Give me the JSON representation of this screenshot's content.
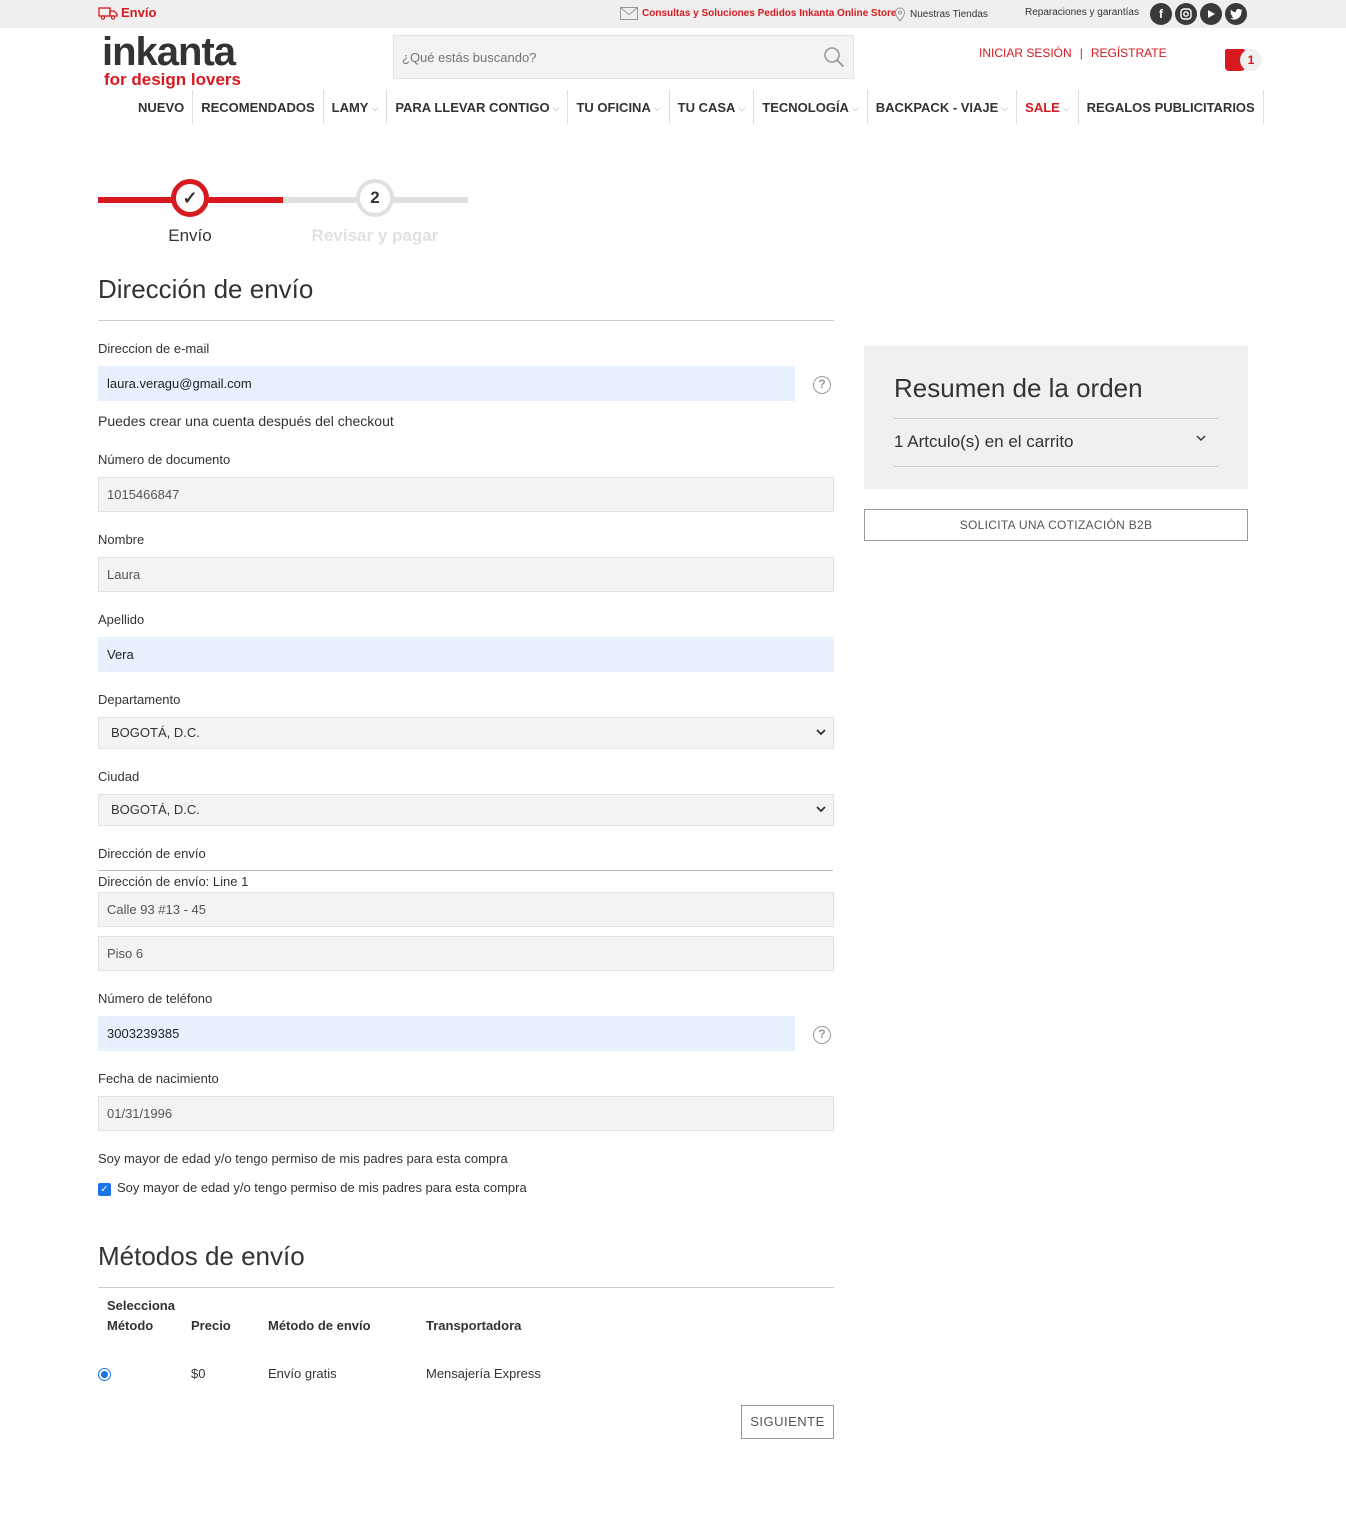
{
  "topbar": {
    "envio": "Envío",
    "consultas": "Consultas y Soluciones Pedidos Inkanta Online Store",
    "tiendas": "Nuestras Tiendas",
    "reparaciones": "Reparaciones y garantías",
    "social": [
      "facebook-icon",
      "instagram-icon",
      "youtube-icon",
      "twitter-icon"
    ]
  },
  "header": {
    "logo_line1": "inkanta",
    "logo_line2": "for design lovers",
    "search_placeholder": "¿Qué estás buscando?",
    "login": "INICIAR SESIÓN",
    "separator": "|",
    "register": "REGÍSTRATE",
    "cart_count": "1"
  },
  "nav": [
    {
      "label": "NUEVO",
      "dropdown": false
    },
    {
      "label": "RECOMENDADOS",
      "dropdown": false
    },
    {
      "label": "LAMY",
      "dropdown": true
    },
    {
      "label": "PARA LLEVAR CONTIGO",
      "dropdown": true
    },
    {
      "label": "TU OFICINA",
      "dropdown": true
    },
    {
      "label": "TU CASA",
      "dropdown": true
    },
    {
      "label": "TECNOLOGÍA",
      "dropdown": true
    },
    {
      "label": "BACKPACK - VIAJE",
      "dropdown": true
    },
    {
      "label": "SALE",
      "dropdown": true
    },
    {
      "label": "REGALOS PUBLICITARIOS",
      "dropdown": false
    }
  ],
  "progress": {
    "step1_label": "Envío",
    "step2_number": "2",
    "step2_label": "Revisar y pagar"
  },
  "shipping_address": {
    "title": "Dirección de envío",
    "email_label": "Direccion de e-mail",
    "email_value": "laura.veragu@gmail.com",
    "account_note": "Puedes crear una cuenta después del checkout",
    "doc_label": "Número de documento",
    "doc_value": "1015466847",
    "name_label": "Nombre",
    "name_value": "Laura",
    "lastname_label": "Apellido",
    "lastname_value": "Vera",
    "department_label": "Departamento",
    "department_value": "BOGOTÁ, D.C.",
    "city_label": "Ciudad",
    "city_value": "BOGOTÁ, D.C.",
    "address_label": "Dirección de envío",
    "address_line1_label": "Dirección de envío: Line 1",
    "address_line1_value": "Calle 93 #13 - 45",
    "address_line2_value": "Piso 6",
    "phone_label": "Número de teléfono",
    "phone_value": "3003239385",
    "birth_label": "Fecha de nacimiento",
    "birth_value": "01/31/1996",
    "age_label": "Soy mayor de edad y/o tengo permiso de mis padres para esta compra",
    "age_checkbox_label": "Soy mayor de edad y/o tengo permiso de mis padres para esta compra",
    "age_checked": true
  },
  "shipping_methods": {
    "title": "Métodos de envío",
    "headers": {
      "select_line1": "Selecciona",
      "select_line2": "Método",
      "price": "Precio",
      "method": "Método de envío",
      "carrier": "Transportadora"
    },
    "rows": [
      {
        "price": "$0",
        "method": "Envío gratis",
        "carrier": "Mensajería Express",
        "selected": true
      }
    ],
    "next": "SIGUIENTE"
  },
  "summary": {
    "title": "Resumen de la orden",
    "items": "1 Artculo(s) en el carrito",
    "b2b": "SOLICITA UNA COTIZACIÓN B2B"
  },
  "colors": {
    "brand": "#d71920",
    "autofill": "#e8f0fe",
    "field_bg": "#f3f3f3"
  }
}
